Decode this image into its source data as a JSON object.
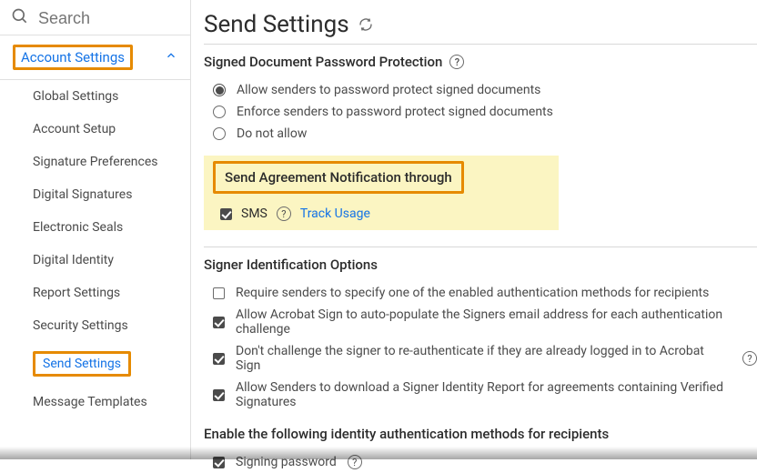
{
  "search": {
    "placeholder": "Search"
  },
  "nav": {
    "section_label": "Account Settings",
    "items": [
      "Global Settings",
      "Account Setup",
      "Signature Preferences",
      "Digital Signatures",
      "Electronic Seals",
      "Digital Identity",
      "Report Settings",
      "Security Settings",
      "Send Settings",
      "Message Templates"
    ],
    "active_index": 8
  },
  "page": {
    "title": "Send Settings"
  },
  "password_section": {
    "heading": "Signed Document Password Protection",
    "options": [
      "Allow senders to password protect signed documents",
      "Enforce senders to password protect signed documents",
      "Do not allow"
    ],
    "selected_index": 0
  },
  "notification_section": {
    "heading": "Send Agreement Notification through",
    "sms_label": "SMS",
    "sms_checked": true,
    "track_usage": "Track Usage"
  },
  "signer_id_section": {
    "heading": "Signer Identification Options",
    "options": [
      {
        "label": "Require senders to specify one of the enabled authentication methods for recipients",
        "checked": false,
        "help": false
      },
      {
        "label": "Allow Acrobat Sign to auto-populate the Signers email address for each authentication challenge",
        "checked": true,
        "help": false
      },
      {
        "label": "Don't challenge the signer to re-authenticate if they are already logged in to Acrobat Sign",
        "checked": true,
        "help": true
      },
      {
        "label": "Allow Senders to download a Signer Identity Report for agreements containing Verified Signatures",
        "checked": true,
        "help": false
      }
    ]
  },
  "auth_methods_section": {
    "heading": "Enable the following identity authentication methods for recipients",
    "options": [
      {
        "label": "Signing password",
        "checked": true,
        "help": true
      }
    ]
  }
}
